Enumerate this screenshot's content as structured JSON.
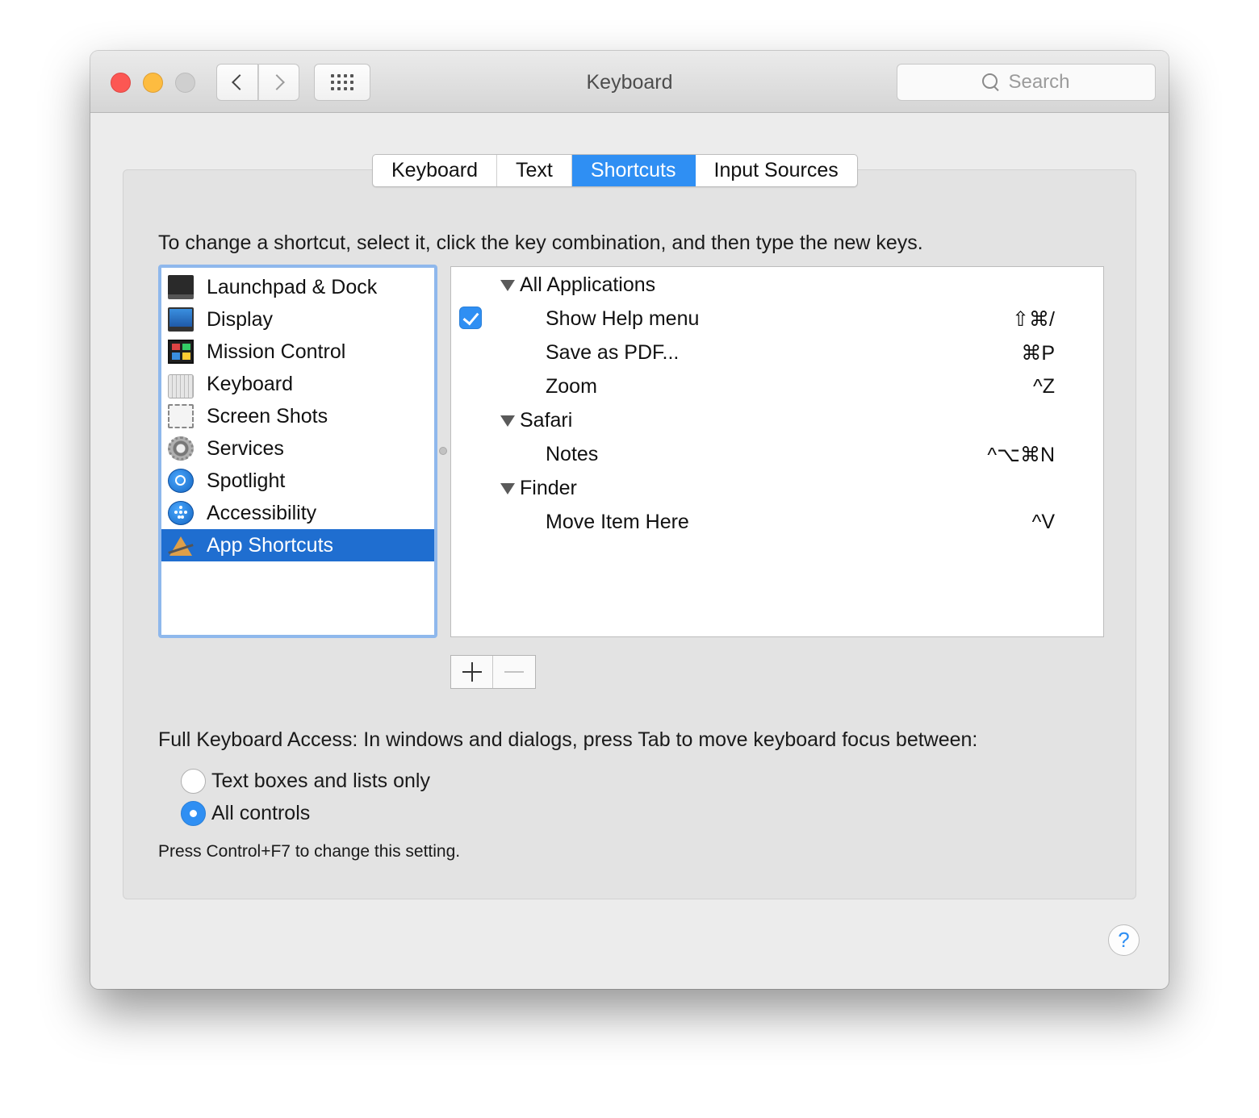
{
  "window": {
    "title": "Keyboard"
  },
  "toolbar": {
    "search_placeholder": "Search",
    "back_icon": "chevron-left-icon",
    "forward_icon": "chevron-right-icon",
    "grid_icon": "grid-icon"
  },
  "tabs": [
    {
      "label": "Keyboard",
      "active": false
    },
    {
      "label": "Text",
      "active": false
    },
    {
      "label": "Shortcuts",
      "active": true
    },
    {
      "label": "Input Sources",
      "active": false
    }
  ],
  "instructions": "To change a shortcut, select it, click the key combination, and then type the new keys.",
  "categories": [
    {
      "label": "Launchpad & Dock",
      "icon": "launchpad-icon"
    },
    {
      "label": "Display",
      "icon": "display-icon"
    },
    {
      "label": "Mission Control",
      "icon": "mission-control-icon"
    },
    {
      "label": "Keyboard",
      "icon": "keyboard-icon"
    },
    {
      "label": "Screen Shots",
      "icon": "screenshot-icon"
    },
    {
      "label": "Services",
      "icon": "gear-icon"
    },
    {
      "label": "Spotlight",
      "icon": "spotlight-icon"
    },
    {
      "label": "Accessibility",
      "icon": "accessibility-icon"
    },
    {
      "label": "App Shortcuts",
      "icon": "app-store-icon",
      "selected": true
    }
  ],
  "shortcuts": [
    {
      "type": "group",
      "label": "All Applications"
    },
    {
      "type": "item",
      "label": "Show Help menu",
      "keys": "⇧⌘/",
      "checked": true
    },
    {
      "type": "item",
      "label": "Save as PDF...",
      "keys": "⌘P"
    },
    {
      "type": "item",
      "label": "Zoom",
      "keys": "^Z"
    },
    {
      "type": "group",
      "label": "Safari"
    },
    {
      "type": "item",
      "label": "Notes",
      "keys": "^⌥⌘N"
    },
    {
      "type": "group",
      "label": "Finder"
    },
    {
      "type": "item",
      "label": "Move Item Here",
      "keys": "^V"
    }
  ],
  "full_keyboard_access": {
    "label": "Full Keyboard Access: In windows and dialogs, press Tab to move keyboard focus between:",
    "options": [
      {
        "label": "Text boxes and lists only",
        "selected": false
      },
      {
        "label": "All controls",
        "selected": true
      }
    ],
    "hint": "Press Control+F7 to change this setting."
  },
  "help": {
    "label": "?"
  },
  "colors": {
    "accent": "#2f8ff3",
    "selection": "#1f6ed0"
  }
}
